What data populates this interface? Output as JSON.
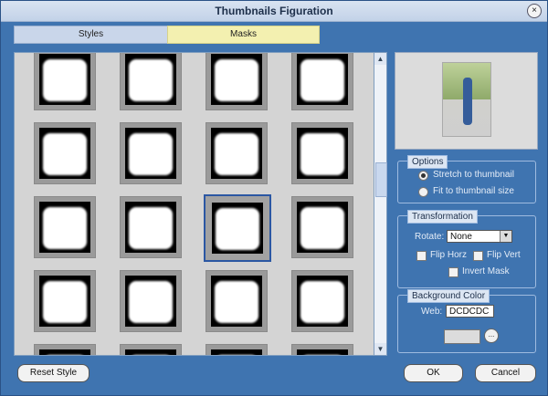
{
  "window": {
    "title": "Thumbnails Figuration",
    "close_symbol": "×"
  },
  "tabs": [
    {
      "label": "Styles"
    },
    {
      "label": "Masks"
    }
  ],
  "thumbnails": {
    "rows": 5,
    "cols": 4,
    "selected_row": 2,
    "selected_col": 2
  },
  "scrollbar": {
    "up_symbol": "▲",
    "down_symbol": "▼"
  },
  "options": {
    "legend": "Options",
    "radio1": "Stretch to thumbnail",
    "radio2": "Fit to thumbnail size",
    "selected": "Stretch to thumbnail"
  },
  "transformation": {
    "legend": "Transformation",
    "rotate_label": "Rotate:",
    "rotate_value": "None",
    "flip_horz": "Flip Horz",
    "flip_vert": "Flip Vert",
    "invert_mask": "Invert Mask"
  },
  "background": {
    "legend": "Background Color",
    "web_label": "Web:",
    "web_value": "DCDCDC",
    "swatch_color": "#dcdcdc",
    "dots": "..."
  },
  "buttons": {
    "reset": "Reset Style",
    "ok": "OK",
    "cancel": "Cancel"
  },
  "colors": {
    "window_bg": "#3f74b0",
    "selected_border": "#2b57a3"
  }
}
